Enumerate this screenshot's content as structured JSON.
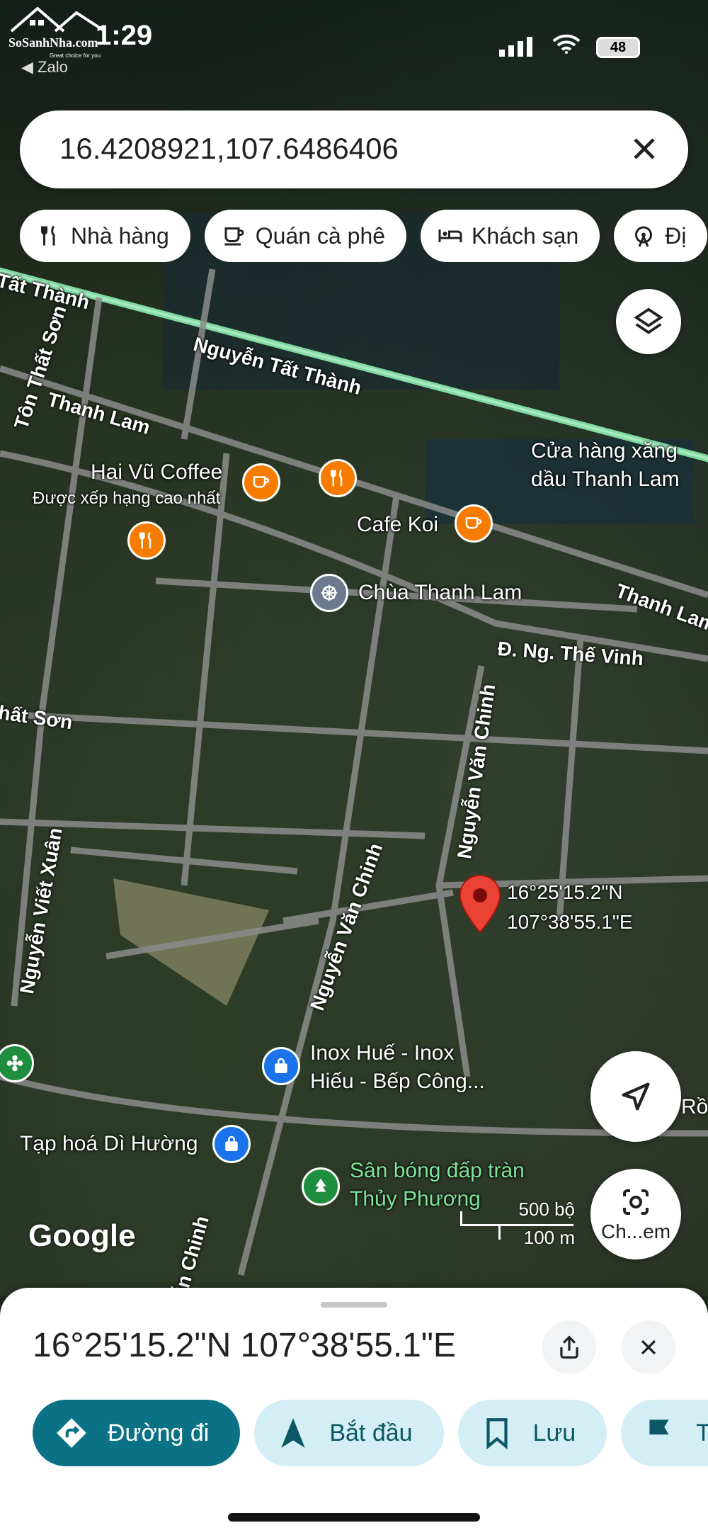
{
  "status_bar": {
    "time": "1:29",
    "back_label": "◀ Zalo",
    "battery": "48"
  },
  "watermark": {
    "brand": "SoSanhNha.com",
    "tagline": "Great choice for you"
  },
  "search": {
    "query": "16.4208921,107.6486406"
  },
  "chips": [
    {
      "label": "Nhà hàng",
      "icon": "fork-knife-icon"
    },
    {
      "label": "Quán cà phê",
      "icon": "coffee-cup-icon"
    },
    {
      "label": "Khách sạn",
      "icon": "bed-icon"
    },
    {
      "label": "Đị",
      "icon": "ferris-wheel-icon"
    }
  ],
  "map": {
    "roads": {
      "nguyen_tat_thanh_1": "Tất Thành",
      "nguyen_tat_thanh_2": "Nguyễn Tất Thành",
      "ton_that_son": "Tôn Thất Sơn",
      "thanh_lam_1": "Thanh Lam",
      "thanh_lam_2": "Thanh Lam",
      "ng_the_vinh": "Đ. Ng. Thế Vinh",
      "nguyen_van_chinh_1": "Nguyễn Văn Chinh",
      "nguyen_van_chinh_2": "Nguyễn Văn Chinh",
      "nguyen_van_chinh_3": "ễn Chinh",
      "that_son": "hất Sơn",
      "nguyen_viet_xuan": "Nguyễn Viết Xuân"
    },
    "places": {
      "hai_vu": "Hai Vũ Coffee",
      "hai_vu_sub": "Được xếp hạng cao nhất",
      "cafe_koi": "Cafe Koi",
      "chua": "Chùa Thanh Lam",
      "cua_hang_1": "Cửa hàng xăng",
      "cua_hang_2": "dầu Thanh Lam",
      "inox_1": "Inox Huế - Inox",
      "inox_2": "Hiếu - Bếp Công...",
      "tap_hoa": "Tạp hoá Dì Hường",
      "san_bong_1": "Sân bóng đấp tràn",
      "san_bong_2": "Thủy Phương",
      "ro": "Rồ"
    },
    "pin_label_lat": "16°25'15.2\"N",
    "pin_label_lng": "107°38'55.1\"E",
    "google_logo": "Google",
    "scale_top": "500 bộ",
    "scale_bottom": "100 m",
    "lens_label": "Ch...em"
  },
  "sheet": {
    "coords": "16°25'15.2\"N 107°38'55.1\"E",
    "actions": [
      {
        "label": "Đường đi",
        "icon": "directions-icon"
      },
      {
        "label": "Bắt đầu",
        "icon": "navigation-arrow-icon"
      },
      {
        "label": "Lưu",
        "icon": "bookmark-icon"
      },
      {
        "label": "Thê",
        "icon": "flag-icon"
      }
    ]
  }
}
